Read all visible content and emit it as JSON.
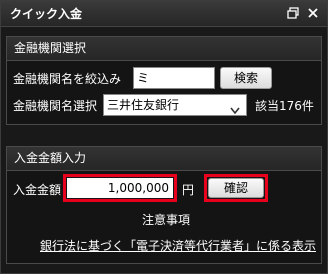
{
  "window": {
    "title": "クイック入金",
    "restore_icon": "restore-icon",
    "close_icon": "close-icon"
  },
  "bank_select": {
    "heading": "金融機関選択",
    "filter_label": "金融機関名を絞込み",
    "filter_value": "ミ",
    "search_button": "検索",
    "select_label": "金融機関名選択",
    "selected_bank": "三井住友銀行",
    "count_text": "該当176件"
  },
  "deposit": {
    "heading": "入金金額入力",
    "amount_label": "入金金額",
    "amount_value": "1,000,000",
    "unit": "円",
    "confirm_button": "確認",
    "notice_link": "注意事項",
    "disclosure_link": "銀行法に基づく「電子決済等代行業者」に係る表示"
  },
  "colors": {
    "highlight": "#e8001c",
    "background": "#191919"
  }
}
